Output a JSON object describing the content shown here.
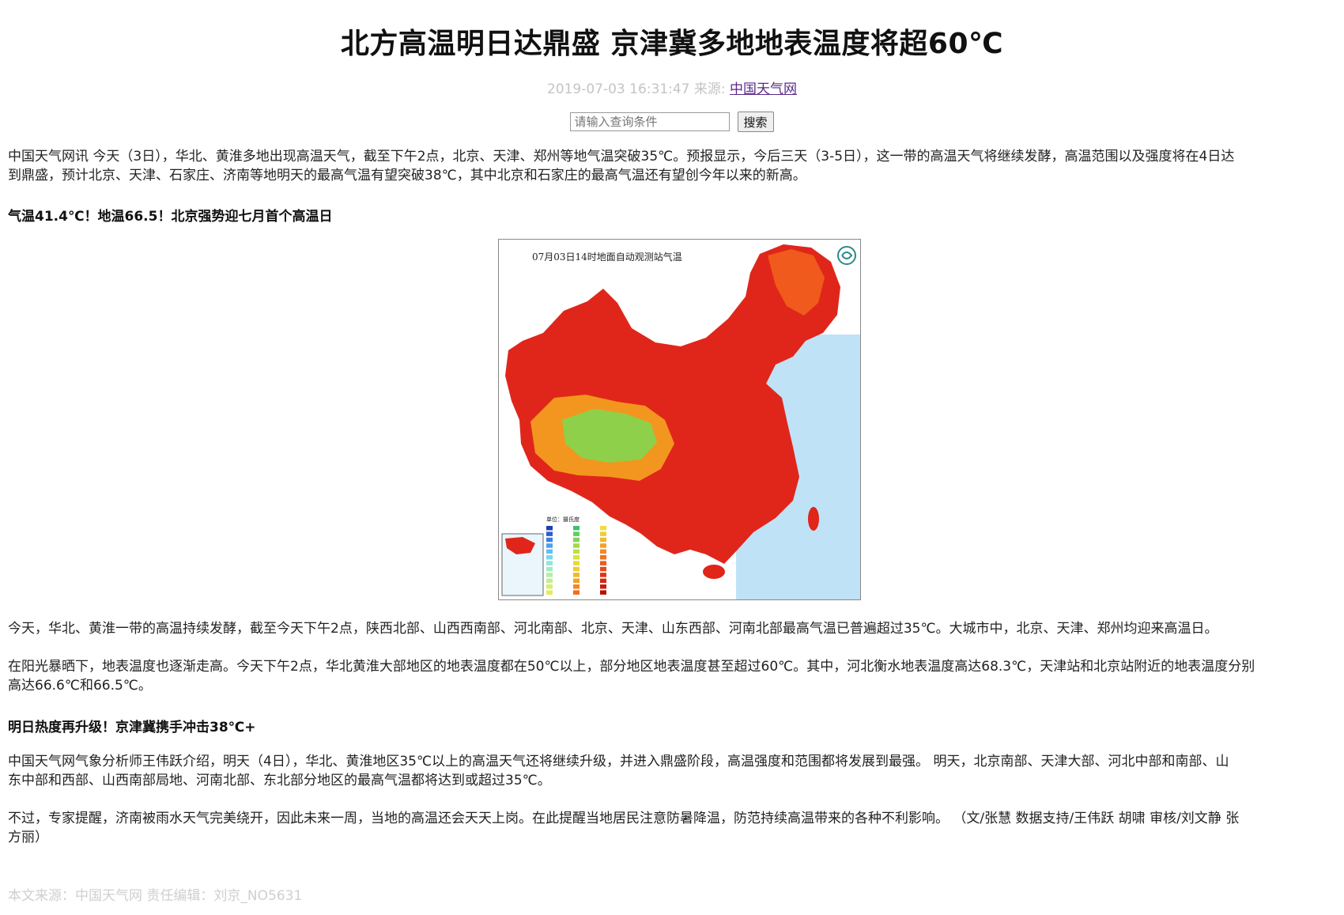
{
  "article": {
    "title": "北方高温明日达鼎盛 京津冀多地地表温度将超60℃",
    "date": "2019-07-03 16:31:47",
    "source_label": "来源:",
    "source_link": "中国天气网"
  },
  "search": {
    "placeholder": "请输入查询条件",
    "button_label": "搜索"
  },
  "body": {
    "p1_line1": "中国天气网讯 今天（3日），华北、黄淮多地出现高温天气，截至下午2点，北京、天津、郑州等地气温突破35℃。预报显示，今后三天（3-5日），这一带的高温天气将继续发酵，高温范围以及强度将在4日达",
    "p1_line2": "到鼎盛，预计北京、天津、石家庄、济南等地明天的最高气温有望突破38℃，其中北京和石家庄的最高气温还有望创今年以来的新高。",
    "heading1": "气温41.4℃！地温66.5！北京强势迎七月首个高温日",
    "map": {
      "title": "07月03日14时地面自动观测站气温",
      "legend_title": "单位：摄氏度",
      "colors": {
        "hot": "#e0261a",
        "warm": "#f05a1c",
        "orange": "#f3961f",
        "yellow": "#f5d23a",
        "green": "#8fd04a",
        "sea": "#bfe2f7"
      }
    },
    "p2": "今天，华北、黄淮一带的高温持续发酵，截至今天下午2点，陕西北部、山西西南部、河北南部、北京、天津、山东西部、河南北部最高气温已普遍超过35℃。大城市中，北京、天津、郑州均迎来高温日。",
    "p3_line1": "在阳光暴晒下，地表温度也逐渐走高。今天下午2点，华北黄淮大部地区的地表温度都在50℃以上，部分地区地表温度甚至超过60℃。其中，河北衡水地表温度高达68.3℃，天津站和北京站附近的地表温度分别",
    "p3_line2": "高达66.6℃和66.5℃。",
    "heading2": "明日热度再升级！京津冀携手冲击38℃+",
    "p4_line1": "中国天气网气象分析师王伟跃介绍，明天（4日），华北、黄淮地区35℃以上的高温天气还将继续升级，并进入鼎盛阶段，高温强度和范围都将发展到最强。 明天，北京南部、天津大部、河北中部和南部、山",
    "p4_line2": "东中部和西部、山西南部局地、河南北部、东北部分地区的最高气温都将达到或超过35℃。",
    "p5_line1": "不过，专家提醒，济南被雨水天气完美绕开，因此未来一周，当地的高温还会天天上岗。在此提醒当地居民注意防暑降温，防范持续高温带来的各种不利影响。 （文/张慧 数据支持/王伟跃 胡啸 审核/刘文静 张",
    "p5_line2": "方丽）"
  },
  "footer": {
    "text": "本文来源：中国天气网 责任编辑：刘京_NO5631"
  }
}
